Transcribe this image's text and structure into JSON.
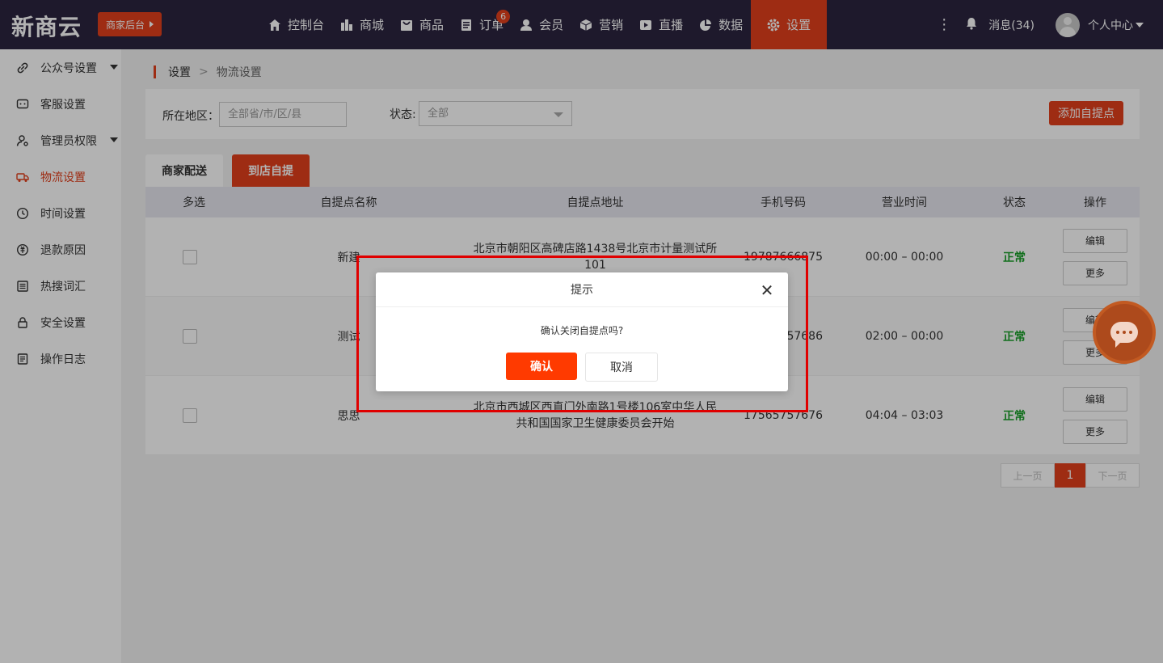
{
  "header": {
    "logo": "新商云",
    "merchant_button": "商家后台",
    "nav": [
      {
        "label": "控制台",
        "icon": "home-icon"
      },
      {
        "label": "商城",
        "icon": "shop-icon"
      },
      {
        "label": "商品",
        "icon": "bag-icon"
      },
      {
        "label": "订单",
        "icon": "order-icon",
        "badge": "6"
      },
      {
        "label": "会员",
        "icon": "user-icon"
      },
      {
        "label": "营销",
        "icon": "box-icon"
      },
      {
        "label": "直播",
        "icon": "live-icon"
      },
      {
        "label": "数据",
        "icon": "pie-chart-icon"
      },
      {
        "label": "设置",
        "icon": "gear-icon",
        "active": true
      }
    ],
    "messages": "消息(34)",
    "user_center": "个人中心"
  },
  "sidebar": {
    "items": [
      {
        "label": "公众号设置",
        "icon": "link-icon",
        "has_arrow": true
      },
      {
        "label": "客服设置",
        "icon": "chat-icon"
      },
      {
        "label": "管理员权限",
        "icon": "admin-icon",
        "has_arrow": true
      },
      {
        "label": "物流设置",
        "icon": "truck-icon",
        "active": true
      },
      {
        "label": "时间设置",
        "icon": "clock-icon"
      },
      {
        "label": "退款原因",
        "icon": "refund-icon"
      },
      {
        "label": "热搜词汇",
        "icon": "list-icon"
      },
      {
        "label": "安全设置",
        "icon": "lock-icon"
      },
      {
        "label": "操作日志",
        "icon": "log-icon"
      }
    ]
  },
  "breadcrumb": {
    "root": "设置",
    "sep": ">",
    "current": "物流设置"
  },
  "filter": {
    "region_label": "所在地区：",
    "region_placeholder": "全部省/市/区/县",
    "status_label": "状态:",
    "status_value": "全部",
    "add_button": "添加自提点"
  },
  "tabs": [
    {
      "label": "商家配送",
      "active": false
    },
    {
      "label": "到店自提",
      "active": true
    }
  ],
  "table": {
    "headers": [
      "多选",
      "自提点名称",
      "自提点地址",
      "手机号码",
      "营业时间",
      "状态",
      "操作"
    ],
    "rows": [
      {
        "name": "新建",
        "address": "北京市朝阳区高碑店路1438号北京市计量测试所101",
        "phone": "19787666875",
        "hours": "00:00 – 00:00",
        "status": "正常"
      },
      {
        "name": "测试",
        "address": "",
        "phone": "17565757686",
        "hours": "02:00 – 00:00",
        "status": "正常"
      },
      {
        "name": "思思",
        "address": "北京市西城区西直门外南路1号楼106室中华人民共和国国家卫生健康委员会开始",
        "phone": "17565757676",
        "hours": "04:04 – 03:03",
        "status": "正常"
      }
    ],
    "edit_label": "编辑",
    "more_label": "更多"
  },
  "pager": {
    "prev": "上一页",
    "current": "1",
    "next": "下一页"
  },
  "dialog": {
    "title": "提示",
    "close": "✕",
    "message": "确认关闭自提点吗?",
    "ok": "确认",
    "cancel": "取消"
  },
  "colors": {
    "accent": "#e2401c",
    "topbar": "#2b2540",
    "status_ok": "#1aa02a"
  }
}
